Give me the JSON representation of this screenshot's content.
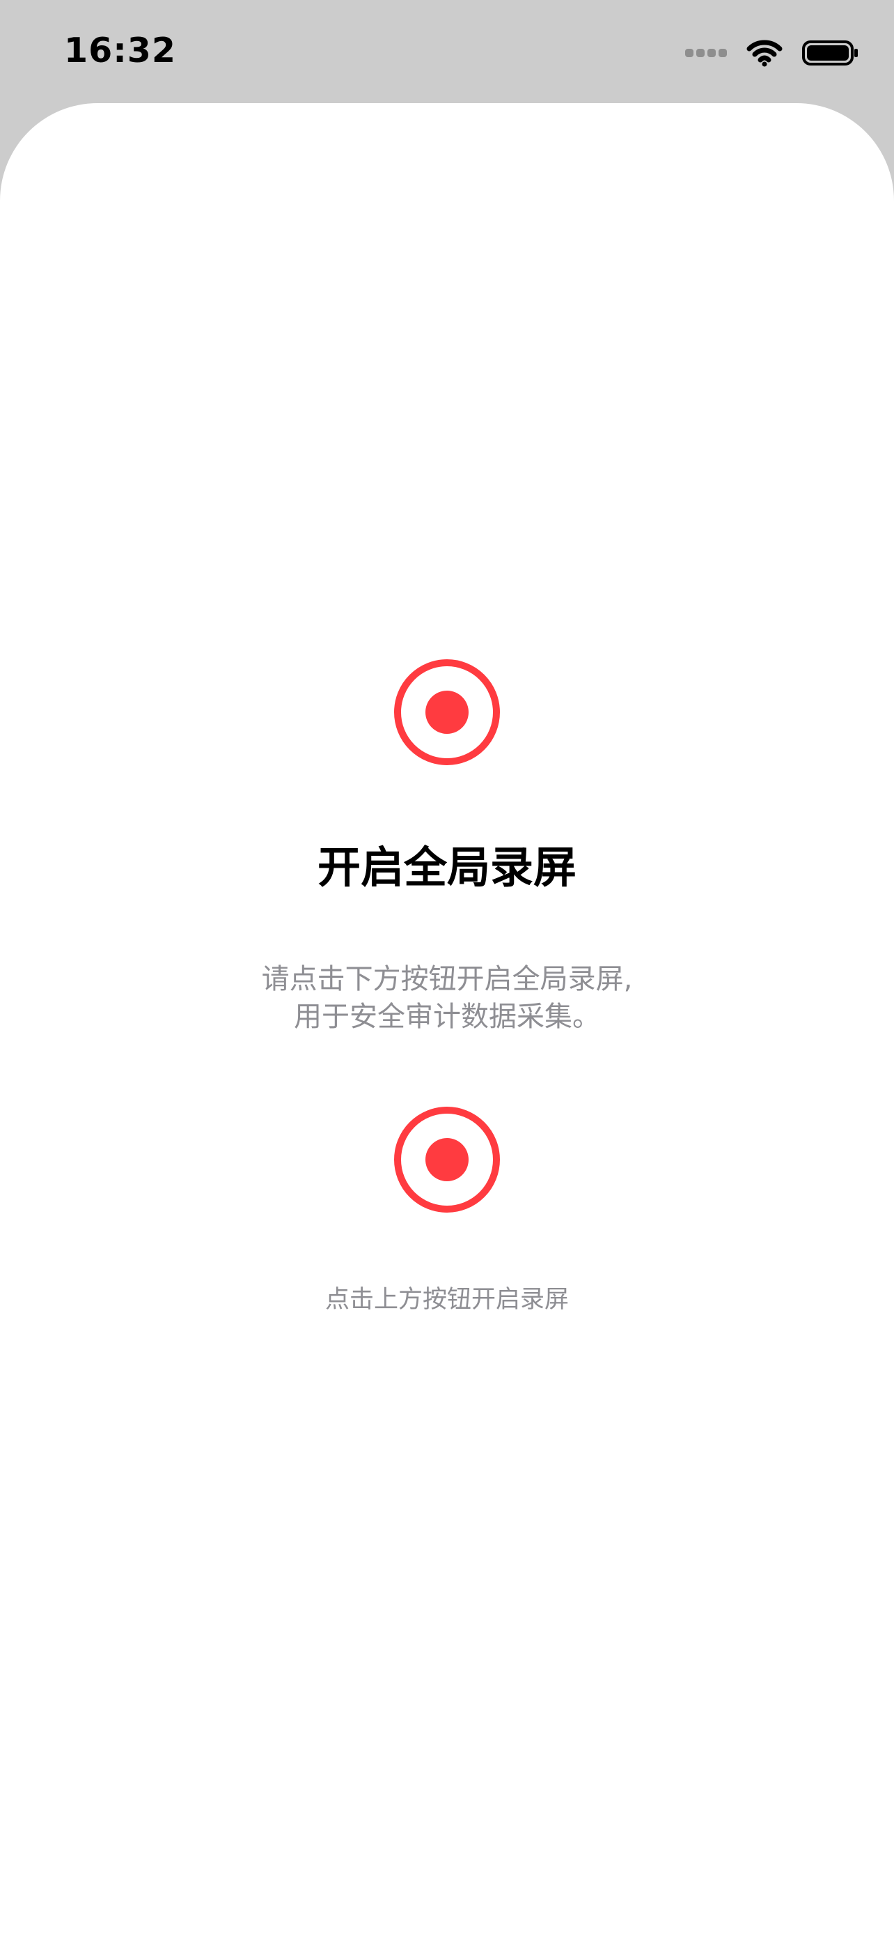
{
  "status_bar": {
    "time": "16:32"
  },
  "main": {
    "title": "开启全局录屏",
    "description_line1": "请点击下方按钮开启全局录屏,",
    "description_line2": "用于安全审计数据采集。",
    "hint": "点击上方按钮开启录屏"
  },
  "icons": {
    "status": [
      "cellular-icon",
      "wifi-icon",
      "battery-icon"
    ],
    "record": "record-icon"
  },
  "colors": {
    "accent": "#ff3b40",
    "background": "#ffffff",
    "status_bar_background": "#cccccc",
    "secondary_text": "#8e8e93"
  }
}
